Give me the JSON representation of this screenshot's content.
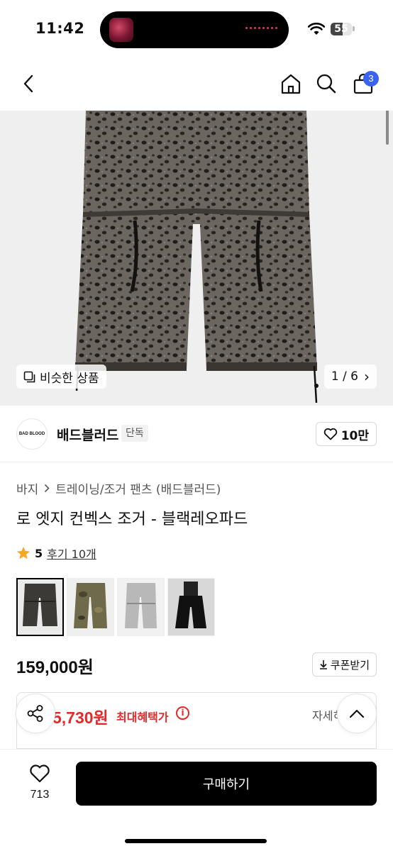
{
  "status_bar": {
    "time": "11:42",
    "battery": "55",
    "battery_level": 0.55
  },
  "nav": {
    "cart_count": "3",
    "icons": [
      "back-arrow-icon",
      "home-icon",
      "search-icon",
      "cart-bag-icon"
    ]
  },
  "hero": {
    "similar_label": "비슷한 상품",
    "counter": "1 / 6",
    "counter_arrow": "›"
  },
  "brand": {
    "logo_text": "BAD BLOOD",
    "name": "배드블러드",
    "exclusive_tag": "단독",
    "likes": "10만"
  },
  "product": {
    "breadcrumb": [
      "바지",
      "트레이닝/조거 팬츠 (배드블러드)"
    ],
    "title": "로 엣지 컨벡스 조거 - 블랙레오파드",
    "rating": "5",
    "reviews": "후기 10개",
    "price": "159,000원",
    "coupon_label": "쿠폰받기"
  },
  "benefit": {
    "price": "5,730원",
    "label": "최대혜택가",
    "info": "i",
    "detail": "자세히"
  },
  "bottom": {
    "wish_count": "713",
    "buy_label": "구매하기"
  },
  "colors": {
    "accent_red": "#e22a2a",
    "badge_blue": "#3a64f0",
    "star": "#f5a623"
  }
}
